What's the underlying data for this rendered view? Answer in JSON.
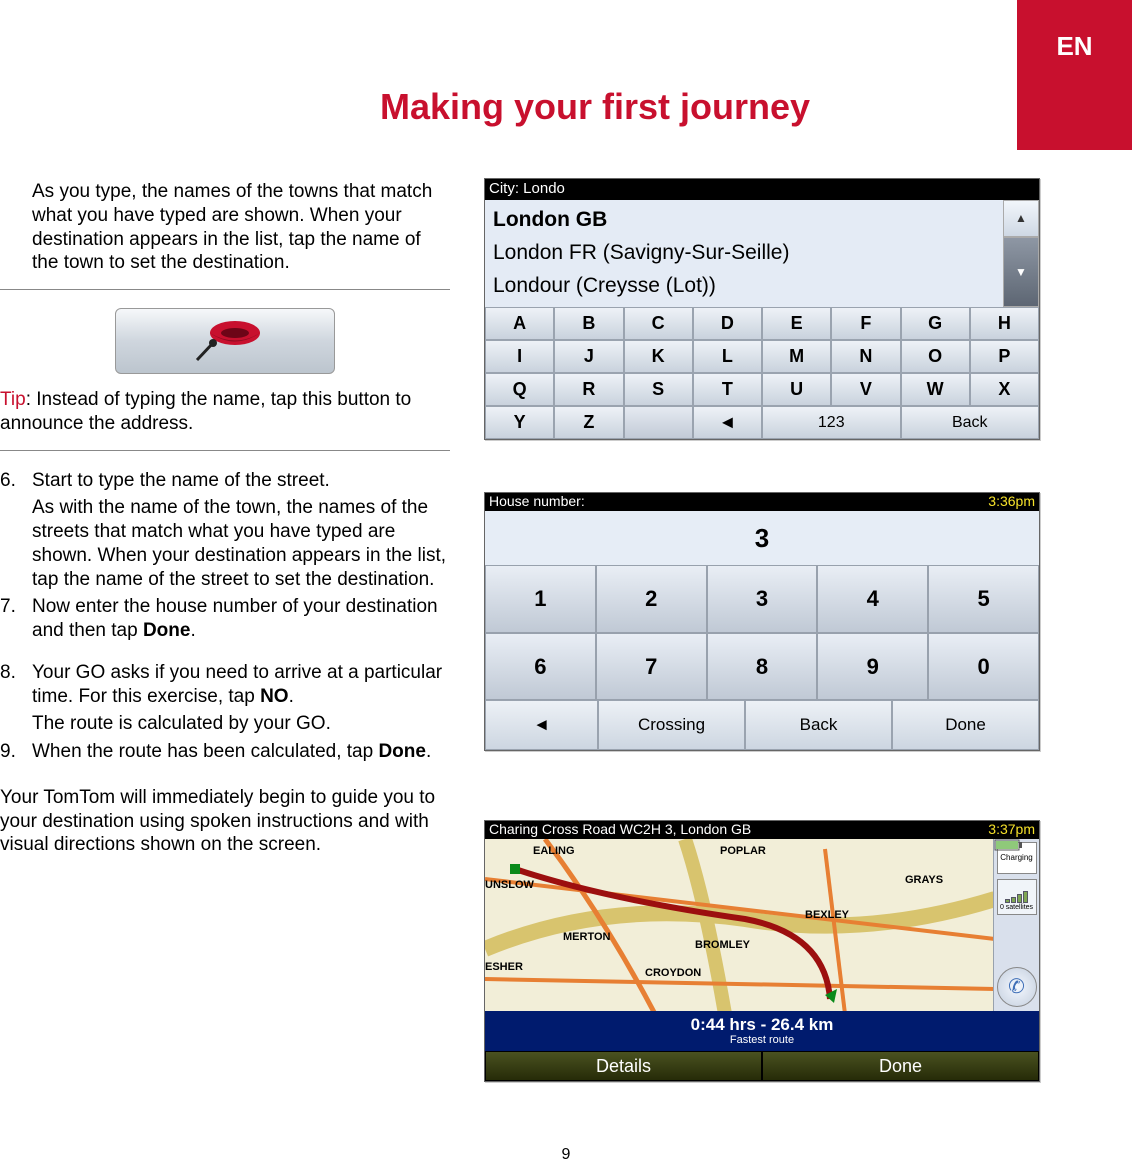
{
  "lang_tab": "EN",
  "title": "Making your first journey",
  "intro": "As you type, the names of the towns that match what you have typed are shown. When your destination appears in the list, tap the name of the town to set the destination.",
  "tip_label": "Tip",
  "tip_text": ": Instead of typing the name, tap this button to announce the address.",
  "steps": {
    "s6_num": "6.",
    "s6a": "Start to type the name of the street.",
    "s6b": "As with the name of the town, the names of the streets that match what you have typed are shown. When your destination appears in the list, tap the name of the street to set the destination.",
    "s7_num": "7.",
    "s7a": "Now enter the house number of your destination and then tap ",
    "s7b": "Done",
    "s7c": ".",
    "s8_num": "8.",
    "s8a": "Your GO asks if you need to arrive at a particular time. For this exercise, tap ",
    "s8b": "NO",
    "s8c": ".",
    "s8d": "The route is calculated by your GO.",
    "s9_num": "9.",
    "s9a": "When the route has been calculated, tap ",
    "s9b": "Done",
    "s9c": "."
  },
  "closing": "Your TomTom will immediately begin to guide you to your destination using spoken instructions and with visual directions shown on the screen.",
  "page_num": "9",
  "screen1": {
    "header": "City: Londo",
    "results": [
      "London GB",
      "London FR (Savigny-Sur-Seille)",
      "Londour (Creysse (Lot))"
    ],
    "rows": [
      [
        "A",
        "B",
        "C",
        "D",
        "E",
        "F",
        "G",
        "H"
      ],
      [
        "I",
        "J",
        "K",
        "L",
        "M",
        "N",
        "O",
        "P"
      ],
      [
        "Q",
        "R",
        "S",
        "T",
        "U",
        "V",
        "W",
        "X"
      ]
    ],
    "y": "Y",
    "z": "Z",
    "arrow": "◄",
    "num": "123",
    "back": "Back"
  },
  "screen2": {
    "header_label": "House number:",
    "time": "3:36pm",
    "value": "3",
    "keys_r1": [
      "1",
      "2",
      "3",
      "4",
      "5"
    ],
    "keys_r2": [
      "6",
      "7",
      "8",
      "9",
      "0"
    ],
    "btn_arrow": "◄",
    "btn_crossing": "Crossing",
    "btn_back": "Back",
    "btn_done": "Done"
  },
  "screen3": {
    "header": "Charing Cross Road WC2H 3, London GB",
    "time": "3:37pm",
    "charging": "Charging",
    "satellites": "0 satellites",
    "labels": {
      "ealing": "EALING",
      "poplar": "POPLAR",
      "unslow": "UNSLOW",
      "grays": "GRAYS",
      "merton": "MERTON",
      "bexley": "BEXLEY",
      "bromley": "BROMLEY",
      "esher": "ESHER",
      "croydon": "CROYDON"
    },
    "info_l1": "0:44 hrs - 26.4 km",
    "info_l2": "Fastest route",
    "btn_details": "Details",
    "btn_done": "Done"
  }
}
